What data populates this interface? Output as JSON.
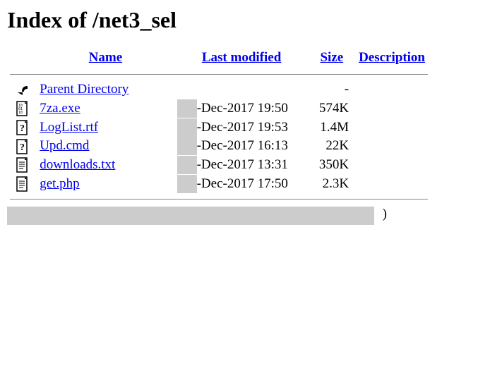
{
  "title": "Index of /net3_sel",
  "headers": {
    "name": "Name",
    "modified": "Last modified",
    "size": "Size",
    "description": "Description"
  },
  "parent": {
    "label": "Parent Directory",
    "size": "-"
  },
  "files": [
    {
      "icon": "binary",
      "name": "7za.exe",
      "modified": "-Dec-2017 19:50",
      "size": "574K"
    },
    {
      "icon": "unknown",
      "name": "LogList.rtf",
      "modified": "-Dec-2017 19:53",
      "size": "1.4M"
    },
    {
      "icon": "unknown",
      "name": "Upd.cmd",
      "modified": "-Dec-2017 16:13",
      "size": "22K"
    },
    {
      "icon": "text",
      "name": "downloads.txt",
      "modified": "-Dec-2017 13:31",
      "size": "350K"
    },
    {
      "icon": "text",
      "name": "get.php",
      "modified": "-Dec-2017 17:50",
      "size": "2.3K"
    }
  ],
  "footer_trail": ")"
}
